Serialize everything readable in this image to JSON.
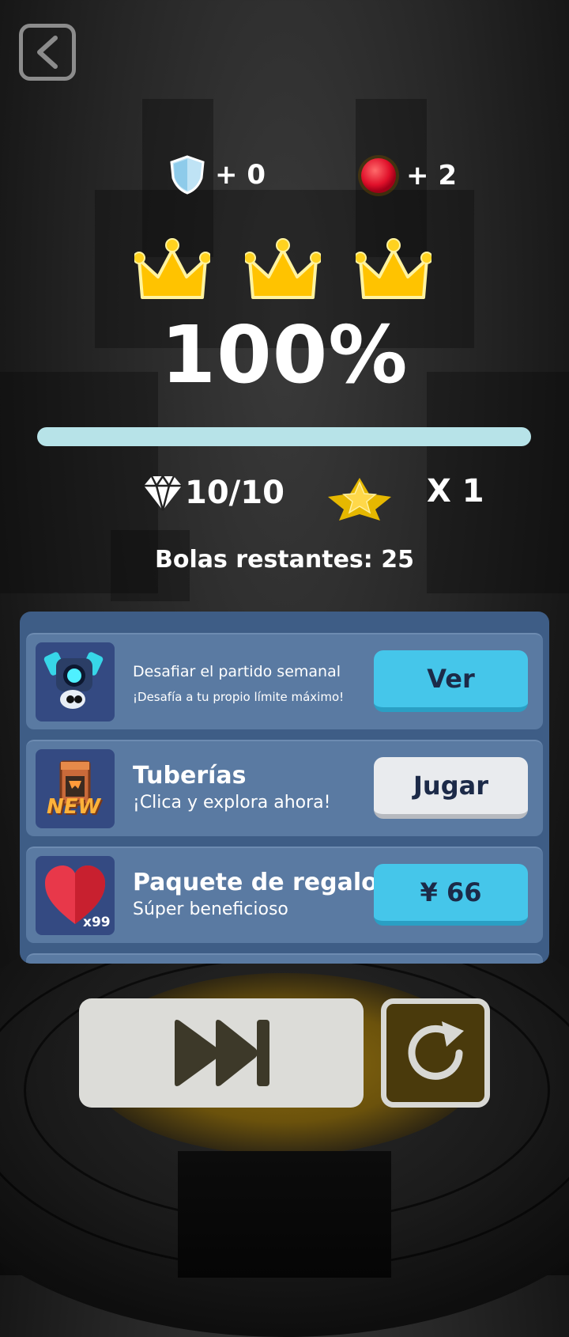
{
  "rewards": {
    "shield": {
      "icon": "shield-icon",
      "text": "+ 0"
    },
    "ball": {
      "icon": "red-ball-icon",
      "text": "+ 2"
    }
  },
  "crowns": {
    "earned": 3,
    "total": 3
  },
  "progress": {
    "percent_text": "100%",
    "fill_fraction": 1.0
  },
  "stats": {
    "diamonds": "10/10",
    "stars_multiplier": "X 1"
  },
  "remaining_balls": "Bolas restantes: 25",
  "cards": [
    {
      "icon": "robot-character-icon",
      "title": "Desafiar el partido semanal",
      "subtitle": "¡Desafía a tu propio límite máximo!",
      "button": "Ver"
    },
    {
      "icon": "pipes-new-game-icon",
      "badge": "NEW",
      "title": "Tuberías",
      "subtitle": "¡Clica y explora ahora!",
      "button": "Jugar"
    },
    {
      "icon": "heart-icon",
      "badge": "x99",
      "title": "Paquete de regalo",
      "subtitle": "Súper beneficioso",
      "button": "¥ 66"
    }
  ],
  "colors": {
    "panel": "#3e5d86",
    "card": "#5a7aa2",
    "button_blue": "#45c6ea",
    "button_gray": "#e9ebee",
    "crown_gold": "#ffc300",
    "progress": "#b7e3e8"
  }
}
